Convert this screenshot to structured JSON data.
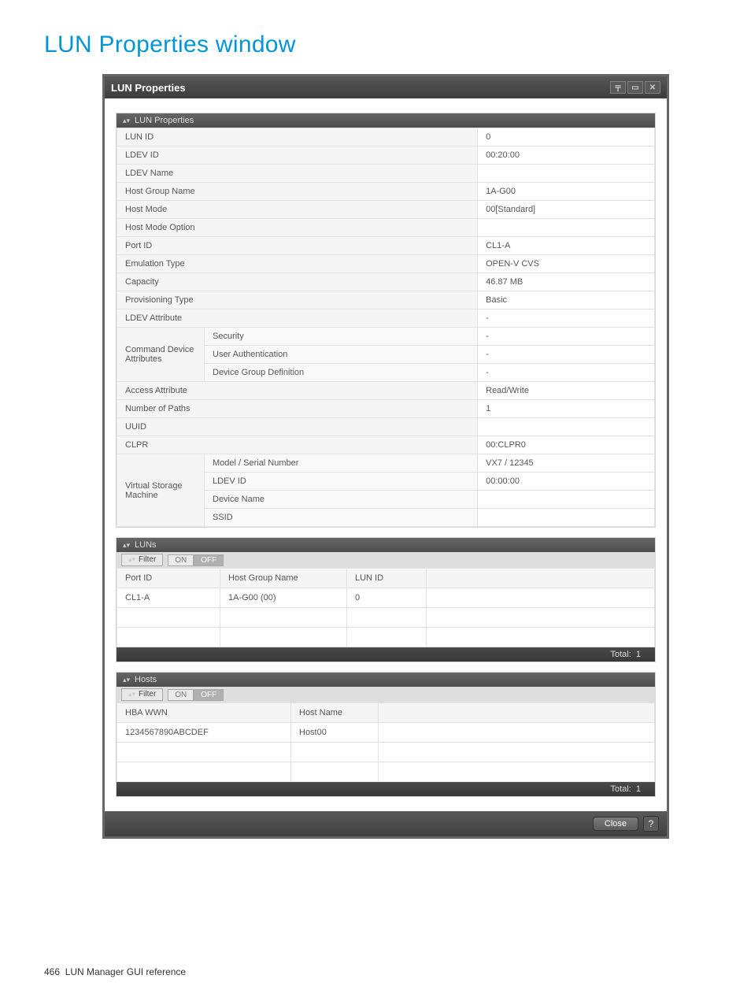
{
  "page": {
    "title": "LUN Properties window",
    "footer_pageno": "466",
    "footer_text": "LUN Manager GUI reference"
  },
  "window": {
    "title": "LUN Properties"
  },
  "controls": {
    "filter_label": "Filter",
    "on": "ON",
    "off": "OFF"
  },
  "props_section": {
    "title": "LUN Properties"
  },
  "props": {
    "lun_id": {
      "label": "LUN ID",
      "value": "0"
    },
    "ldev_id": {
      "label": "LDEV ID",
      "value": "00:20:00"
    },
    "ldev_name": {
      "label": "LDEV Name",
      "value": ""
    },
    "host_group_name": {
      "label": "Host Group Name",
      "value": "1A-G00"
    },
    "host_mode": {
      "label": "Host Mode",
      "value": "00[Standard]"
    },
    "host_mode_option": {
      "label": "Host Mode Option",
      "value": ""
    },
    "port_id": {
      "label": "Port ID",
      "value": "CL1-A"
    },
    "emulation_type": {
      "label": "Emulation Type",
      "value": "OPEN-V CVS"
    },
    "capacity": {
      "label": "Capacity",
      "value": "46.87 MB"
    },
    "provisioning_type": {
      "label": "Provisioning Type",
      "value": "Basic"
    },
    "ldev_attribute": {
      "label": "LDEV Attribute",
      "value": "-"
    },
    "cda": {
      "group_label": "Command Device Attributes",
      "security": {
        "label": "Security",
        "value": "-"
      },
      "user_auth": {
        "label": "User Authentication",
        "value": "-"
      },
      "dev_grp_def": {
        "label": "Device Group Definition",
        "value": "-"
      }
    },
    "access_attribute": {
      "label": "Access Attribute",
      "value": "Read/Write"
    },
    "num_paths": {
      "label": "Number of Paths",
      "value": "1"
    },
    "uuid": {
      "label": "UUID",
      "value": ""
    },
    "clpr": {
      "label": "CLPR",
      "value": "00:CLPR0"
    },
    "vsm": {
      "group_label": "Virtual Storage Machine",
      "model_serial": {
        "label": "Model / Serial Number",
        "value": "VX7 / 12345"
      },
      "ldev_id": {
        "label": "LDEV ID",
        "value": "00:00:00"
      },
      "device_name": {
        "label": "Device Name",
        "value": ""
      },
      "ssid": {
        "label": "SSID",
        "value": ""
      }
    }
  },
  "luns_section": {
    "title": "LUNs",
    "columns": [
      "Port ID",
      "Host Group Name",
      "LUN ID"
    ],
    "rows": [
      {
        "port_id": "CL1-A",
        "host_group_name": "1A-G00 (00)",
        "lun_id": "0"
      }
    ],
    "total_label": "Total:",
    "total": "1"
  },
  "hosts_section": {
    "title": "Hosts",
    "columns": [
      "HBA WWN",
      "Host Name"
    ],
    "rows": [
      {
        "hba_wwn": "1234567890ABCDEF",
        "host_name": "Host00"
      }
    ],
    "total_label": "Total:",
    "total": "1"
  },
  "footer": {
    "close": "Close",
    "help": "?"
  }
}
